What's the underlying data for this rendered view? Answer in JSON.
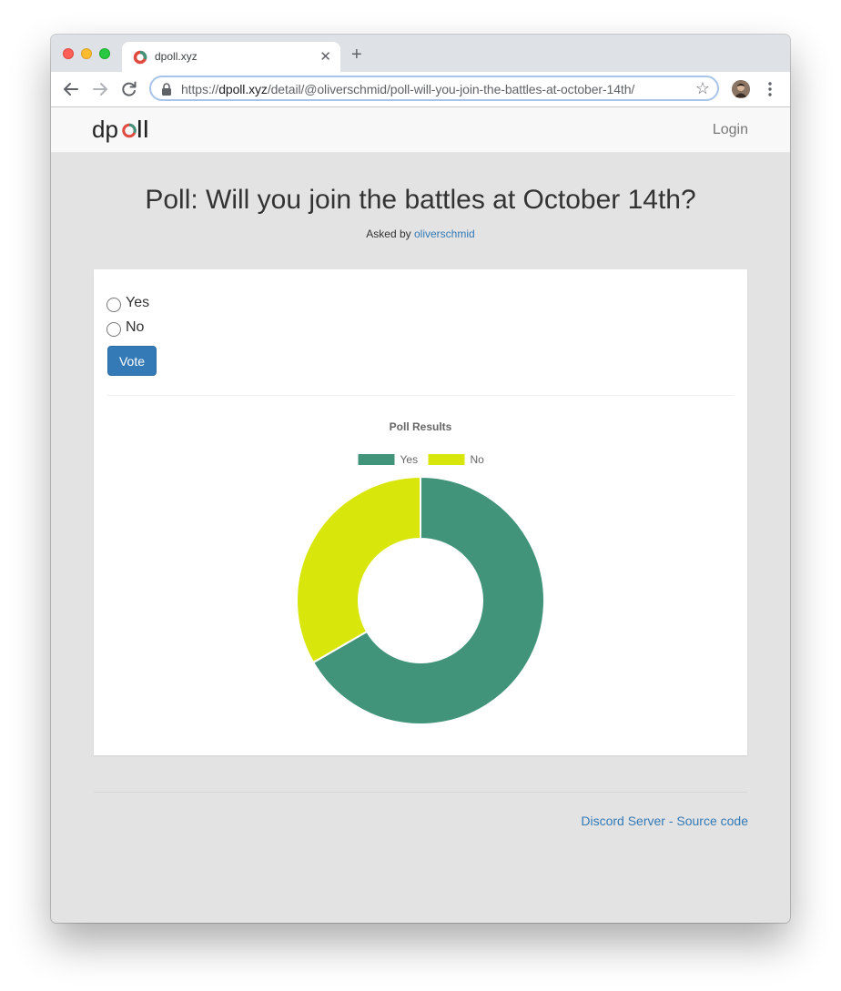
{
  "browser": {
    "tab_title": "dpoll.xyz",
    "new_tab_symbol": "+",
    "close_symbol": "✕",
    "url_scheme": "https://",
    "url_host": "dpoll.xyz",
    "url_path": "/detail/@oliverschmid/poll-will-you-join-the-battles-at-october-14th/"
  },
  "navbar": {
    "logo_text": "dpoll",
    "login_label": "Login"
  },
  "poll": {
    "title": "Poll: Will you join the battles at October 14th?",
    "asked_by_prefix": "Asked by",
    "author": "oliverschmid",
    "options": [
      "Yes",
      "No"
    ],
    "vote_label": "Vote"
  },
  "chart_data": {
    "type": "pie",
    "donut": true,
    "title": "Poll Results",
    "legend_position": "top",
    "categories": [
      "Yes",
      "No"
    ],
    "values": [
      2,
      1
    ],
    "colors": [
      "#41937a",
      "#d9e60c"
    ]
  },
  "footer": {
    "discord_label": "Discord Server",
    "separator": "-",
    "source_label": "Source code"
  },
  "colors": {
    "link": "#337ab7",
    "button": "#337ab7",
    "page_bg": "#e3e3e3"
  },
  "icons": {
    "favicon": "dpoll-ring-icon",
    "back": "arrow-left-icon",
    "forward": "arrow-right-icon",
    "reload": "reload-icon",
    "lock": "lock-icon",
    "bookmark": "star-icon",
    "menu": "kebab-menu-icon"
  }
}
